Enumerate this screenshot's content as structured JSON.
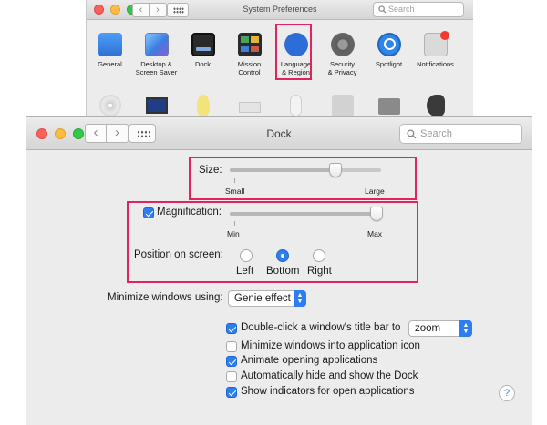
{
  "system_preferences": {
    "title": "System Preferences",
    "search_placeholder": "Search",
    "panes": [
      {
        "label": "General",
        "icon": "general-icon"
      },
      {
        "label": "Desktop &\nScreen Saver",
        "icon": "desktop-icon"
      },
      {
        "label": "Dock",
        "icon": "dock-icon"
      },
      {
        "label": "Mission\nControl",
        "icon": "mission-control-icon"
      },
      {
        "label": "Language\n& Region",
        "icon": "language-region-icon"
      },
      {
        "label": "Security\n& Privacy",
        "icon": "security-privacy-icon"
      },
      {
        "label": "Spotlight",
        "icon": "spotlight-icon"
      },
      {
        "label": "Notifications",
        "icon": "notifications-icon"
      }
    ],
    "row2_icons": [
      "cd-icon",
      "display-icon",
      "energy-icon",
      "keyboard-icon",
      "mouse-icon",
      "trackpad-icon",
      "printer-icon",
      "sound-icon"
    ]
  },
  "dock": {
    "title": "Dock",
    "search_placeholder": "Search",
    "size": {
      "label": "Size:",
      "min_label": "Small",
      "max_label": "Large",
      "value": 0.7
    },
    "magnification": {
      "label": "Magnification:",
      "checked": true,
      "min_label": "Min",
      "max_label": "Max",
      "value": 0.97
    },
    "position": {
      "label": "Position on screen:",
      "options": [
        "Left",
        "Bottom",
        "Right"
      ],
      "selected": "Bottom"
    },
    "minimize": {
      "label": "Minimize windows using:",
      "value": "Genie effect"
    },
    "double_click": {
      "label": "Double-click a window's title bar to",
      "checked": true,
      "value": "zoom"
    },
    "checkboxes": [
      {
        "label": "Minimize windows into application icon",
        "checked": false
      },
      {
        "label": "Animate opening applications",
        "checked": true
      },
      {
        "label": "Automatically hide and show the Dock",
        "checked": false
      },
      {
        "label": "Show indicators for open applications",
        "checked": true
      }
    ],
    "help": "?"
  },
  "colors": {
    "highlight": "#e0245e",
    "accent": "#2d7ef3"
  }
}
